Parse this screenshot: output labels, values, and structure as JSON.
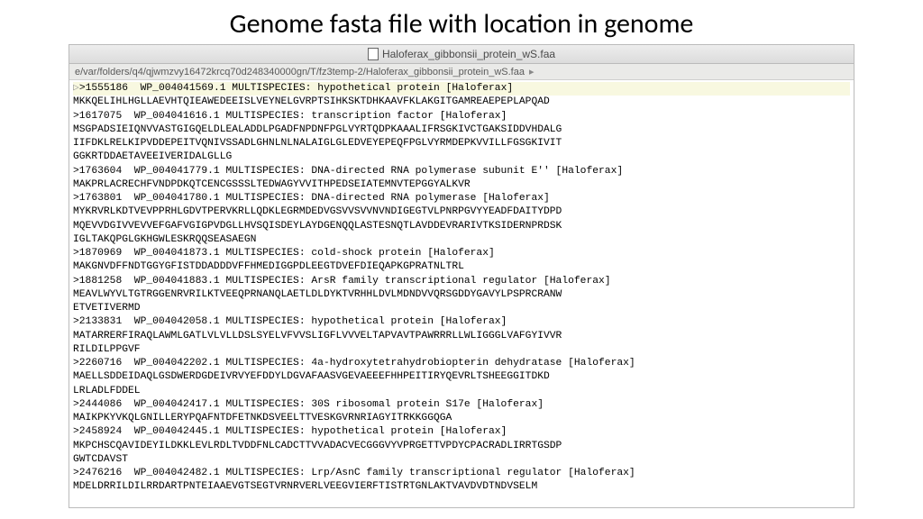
{
  "slide": {
    "title": "Genome fasta file with location in genome"
  },
  "window": {
    "filename": "Haloferax_gibbonsii_protein_wS.faa",
    "path_prefix": "e/var/folders/q4/qjwmzvy16472krcq70d248340000gn/T/fz3temp-2/Haloferax_gibbonsii_protein_wS.faa"
  },
  "fasta": {
    "lines": [
      ">1555186  WP_004041569.1 MULTISPECIES: hypothetical protein [Haloferax]",
      "MKKQELIHLHGLLAEVHTQIEAWEDEEISLVEYNELGVRPTSIHKSKTDHKAAVFKLAKGITGAMREAEPEPLAPQAD",
      ">1617075  WP_004041616.1 MULTISPECIES: transcription factor [Haloferax]",
      "MSGPADSIEIQNVVASTGIGQELDLEALADDLPGADFNPDNFPGLVYRTQDPKAAALIFRSGKIVCTGAKSIDDVHDALG",
      "IIFDKLRELKIPVDDEPEITVQNIVSSADLGHNLNLNALAIGLGLEDVEYEPEQFPGLVYRMDEPKVVILLFGSGKIVIT",
      "GGKRTDDAETAVEEIVERIDALGLLG",
      ">1763604  WP_004041779.1 MULTISPECIES: DNA-directed RNA polymerase subunit E'' [Haloferax]",
      "MAKPRLACRECHFVNDPDKQTCENCGSSSLTEDWAGYVVITHPEDSEIATEMNVTEPGGYALKVR",
      ">1763801  WP_004041780.1 MULTISPECIES: DNA-directed RNA polymerase [Haloferax]",
      "MYKRVRLKDTVEVPPRHLGDVTPERVKRLLQDKLEGRMDEDVGSVVSVVNVNDIGEGTVLPNRPGVYYEADFDAITYDPD",
      "MQEVVDGIVVEVVEFGAFVGIGPVDGLLHVSQISDEYLAYDGENQQLASTESNQTLAVDDEVRARIVTKSIDERNPRDSK",
      "IGLTAKQPGLGKHGWLESKRQQSEASAEGN",
      ">1870969  WP_004041873.1 MULTISPECIES: cold-shock protein [Haloferax]",
      "MAKGNVDFFNDTGGYGFISTDDADDDVFFHMEDIGGPDLEEGTDVEFDIEQAPKGPRATNLTRL",
      ">1881258  WP_004041883.1 MULTISPECIES: ArsR family transcriptional regulator [Haloferax]",
      "MEAVLWYVLTGTRGGENRVRILKTVEEQPRNANQLAETLDLDYKTVRHHLDVLMDNDVVQRSGDDYGAVYLPSPRCRANW",
      "ETVETIVERMD",
      ">2133831  WP_004042058.1 MULTISPECIES: hypothetical protein [Haloferax]",
      "MATARRERFIRAQLAWMLGATLVLVLLDSLSYELVFVVSLIGFLVVVELTAPVAVTPAWRRRLLWLIGGGLVAFGYIVVR",
      "RILDILPPGVF",
      ">2260716  WP_004042202.1 MULTISPECIES: 4a-hydroxytetrahydrobiopterin dehydratase [Haloferax]",
      "MAELLSDDEIDAQLGSDWERDGDEIVRVYEFDDYLDGVAFAASVGEVAEEEFHHPEITIRYQEVRLTSHEEGGITDKD",
      "LRLADLFDDEL",
      ">2444086  WP_004042417.1 MULTISPECIES: 30S ribosomal protein S17e [Haloferax]",
      "MAIKPKYVKQLGNILLERYPQAFNTDFETNKDSVEELTTVESKGVRNRIAGYITRKKGGQGA",
      ">2458924  WP_004042445.1 MULTISPECIES: hypothetical protein [Haloferax]",
      "MKPCHSCQAVIDEYILDKKLEVLRDLTVDDFNLCADCTTVVADACVECGGGVYVPRGETTVPDYCPACRADLIRRTGSDP",
      "GWTCDAVST",
      ">2476216  WP_004042482.1 MULTISPECIES: Lrp/AsnC family transcriptional regulator [Haloferax]",
      "MDELDRRILDILRRDARTPNTEIAAEVGTSEGTVRNRVERLVEEGVIERFTISTRTGNLAKTVAVDVDTNDVSELM"
    ]
  }
}
